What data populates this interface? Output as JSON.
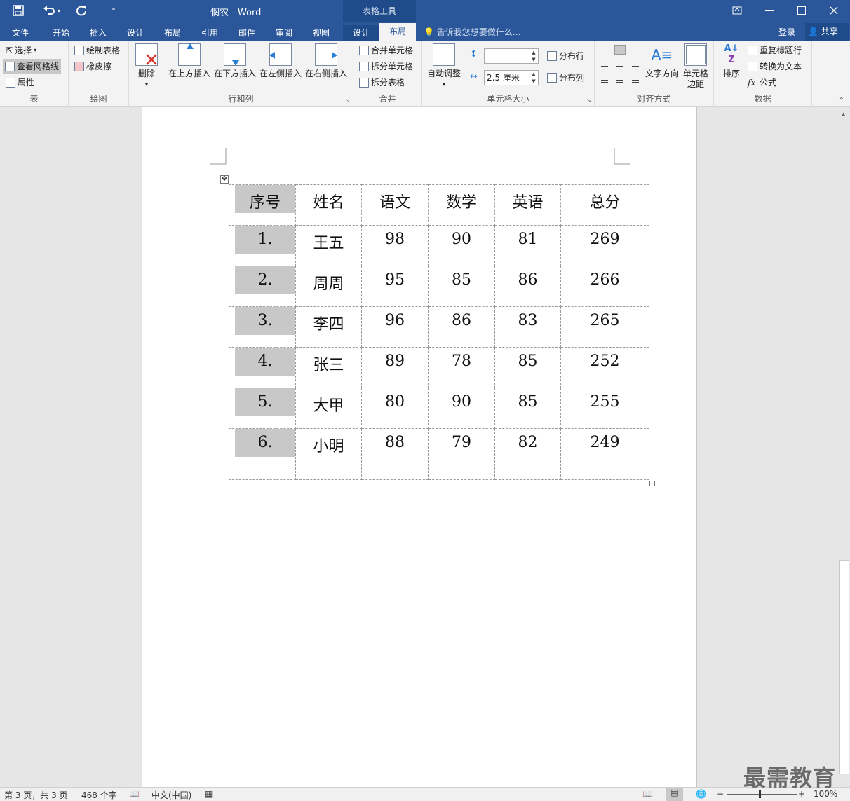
{
  "titlebar": {
    "doc_title": "惘农 - Word",
    "context_label": "表格工具",
    "qat": {
      "save_icon": "save-icon",
      "undo_icon": "undo-icon",
      "redo_icon": "redo-icon",
      "customize_icon": "customize-qat-icon"
    }
  },
  "tabs": [
    "文件",
    "开始",
    "插入",
    "设计",
    "布局",
    "引用",
    "邮件",
    "审阅",
    "视图",
    "设计",
    "布局"
  ],
  "tell_me": {
    "placeholder": "告诉我您想要做什么..."
  },
  "account": {
    "signin": "登录",
    "share": "共享"
  },
  "ribbon": {
    "table": {
      "label": "表",
      "select": "选择",
      "view_gridlines": "查看网格线",
      "properties": "属性"
    },
    "draw": {
      "label": "绘图",
      "draw_table": "绘制表格",
      "eraser": "橡皮擦"
    },
    "rows_cols": {
      "label": "行和列",
      "delete": "删除",
      "insert_above": "在上方插入",
      "insert_below": "在下方插入",
      "insert_left": "在左侧插入",
      "insert_right": "在右侧插入"
    },
    "merge": {
      "label": "合并",
      "merge_cells": "合并单元格",
      "split_cells": "拆分单元格",
      "split_table": "拆分表格"
    },
    "cell_size": {
      "label": "单元格大小",
      "autofit": "自动调整",
      "height_value": "",
      "width_value": "2.5 厘米",
      "distribute_rows": "分布行",
      "distribute_cols": "分布列"
    },
    "alignment": {
      "label": "对齐方式",
      "text_direction": "文字方向",
      "cell_margins_1": "单元格",
      "cell_margins_2": "边距"
    },
    "data": {
      "label": "数据",
      "sort": "排序",
      "repeat_header": "重复标题行",
      "convert_to_text": "转换为文本",
      "formula": "公式"
    }
  },
  "table": {
    "headers": [
      "序号",
      "姓名",
      "语文",
      "数学",
      "英语",
      "总分"
    ],
    "rows": [
      [
        "1.",
        "王五",
        "98",
        "90",
        "81",
        "269"
      ],
      [
        "2.",
        "周周",
        "95",
        "85",
        "86",
        "266"
      ],
      [
        "3.",
        "李四",
        "96",
        "86",
        "83",
        "265"
      ],
      [
        "4.",
        "张三",
        "89",
        "78",
        "85",
        "252"
      ],
      [
        "5.",
        "大甲",
        "80",
        "90",
        "85",
        "255"
      ],
      [
        "6.",
        "小明",
        "88",
        "79",
        "82",
        "249"
      ]
    ]
  },
  "status": {
    "page": "第 3 页，共 3 页",
    "words": "468 个字",
    "language": "中文(中国)",
    "zoom": "100%"
  },
  "watermark": "最需教育"
}
